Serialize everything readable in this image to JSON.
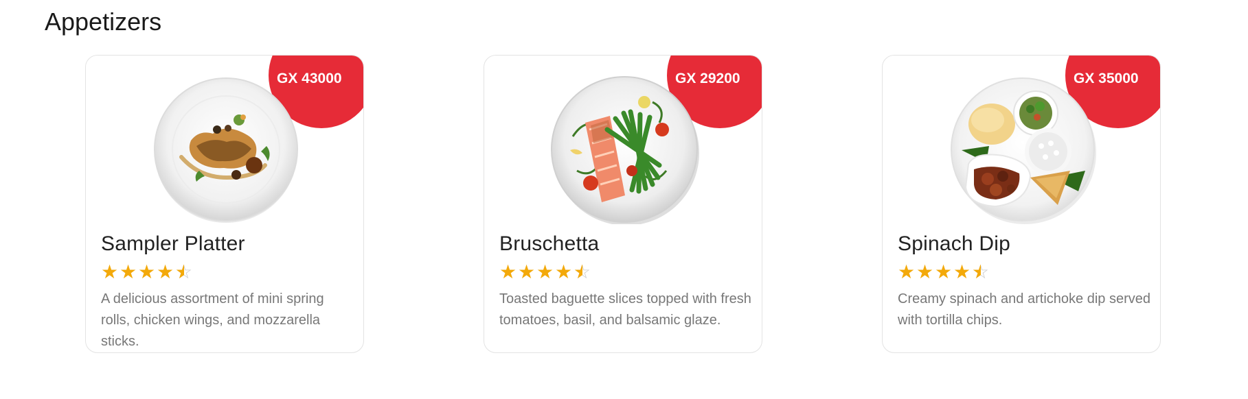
{
  "section": {
    "title": "Appetizers"
  },
  "colors": {
    "price_badge": "#e62b37",
    "star": "#f3a90a",
    "star_empty": "#c9c9c9",
    "description": "#777777"
  },
  "items": [
    {
      "price": "GX 43000",
      "name": "Sampler Platter",
      "rating": 4.5,
      "rating_max": 5,
      "description": "A delicious assortment of mini spring rolls, chicken wings, and mozzarella sticks."
    },
    {
      "price": "GX 29200",
      "name": "Bruschetta",
      "rating": 4.5,
      "rating_max": 5,
      "description": "Toasted baguette slices topped with fresh tomatoes, basil, and balsamic glaze."
    },
    {
      "price": "GX 35000",
      "name": "Spinach Dip",
      "rating": 4.5,
      "rating_max": 5,
      "description": "Creamy spinach and artichoke dip served with tortilla chips."
    }
  ]
}
